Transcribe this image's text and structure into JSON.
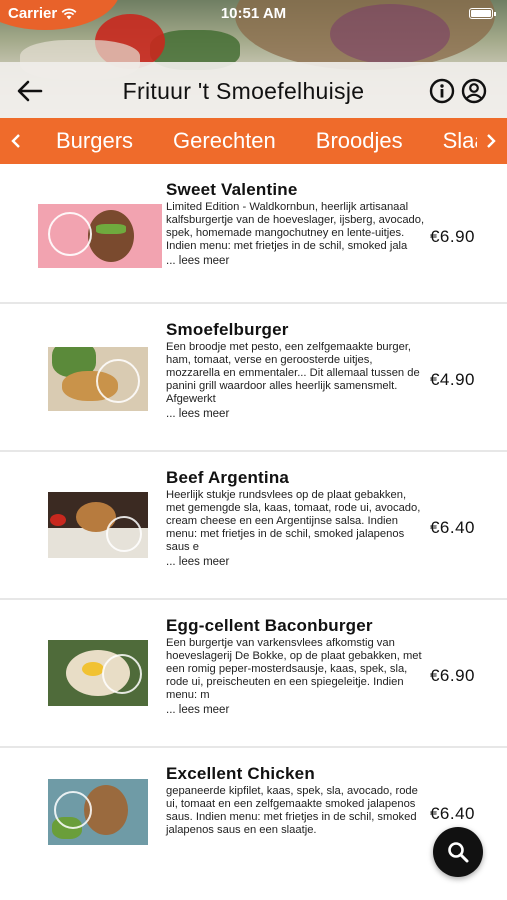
{
  "status_bar": {
    "carrier": "Carrier",
    "time": "10:51 AM"
  },
  "header": {
    "title": "Frituur 't Smoefelhuisje",
    "back_icon": "arrow-left-icon",
    "info_icon": "info-circle-icon",
    "account_icon": "user-circle-icon"
  },
  "categories": {
    "tabs": [
      "Burgers",
      "Gerechten",
      "Broodjes",
      "Slaa"
    ],
    "accent_color": "#ef6b2b"
  },
  "products": [
    {
      "name": "Sweet Valentine",
      "description": "Limited Edition - Waldkornbun, heerlijk artisanaal kalfsburgertje van de hoeveslager, ijsberg, avocado, spek, homemade mangochutney en lente-uitjes. Indien menu: met frietjes in de schil, smoked jala",
      "more": "... lees meer",
      "price": "€6.90"
    },
    {
      "name": "Smoefelburger",
      "description": "Een broodje met pesto, een zelfgemaakte burger, ham, tomaat, verse en geroosterde uitjes, mozzarella en emmentaler... Dit allemaal tussen de panini grill waardoor alles heerlijk samensmelt. Afgewerkt",
      "more": "... lees meer",
      "price": "€4.90"
    },
    {
      "name": "Beef Argentina",
      "description": "Heerlijk stukje rundsvlees op de plaat gebakken, met gemengde sla, kaas, tomaat, rode ui, avocado, cream cheese en een Argentijnse salsa. Indien menu: met frietjes in de schil, smoked jalapenos saus e",
      "more": "... lees meer",
      "price": "€6.40"
    },
    {
      "name": "Egg-cellent Baconburger",
      "description": "Een burgertje van varkensvlees afkomstig van hoeveslagerij De Bokke, op de plaat gebakken, met een romig peper-mosterdsausje, kaas, spek, sla, rode ui, preischeuten en een spiegeleitje. Indien menu: m",
      "more": "... lees meer",
      "price": "€6.90"
    },
    {
      "name": "Excellent Chicken",
      "description": "gepaneerde kipfilet, kaas, spek, sla, avocado, rode ui, tomaat en een zelfgemaakte smoked jalapenos saus. Indien menu: met frietjes in de schil, smoked jalapenos saus en een slaatje.",
      "more": "",
      "price": "€6.40"
    }
  ],
  "search_fab_icon": "search-icon"
}
